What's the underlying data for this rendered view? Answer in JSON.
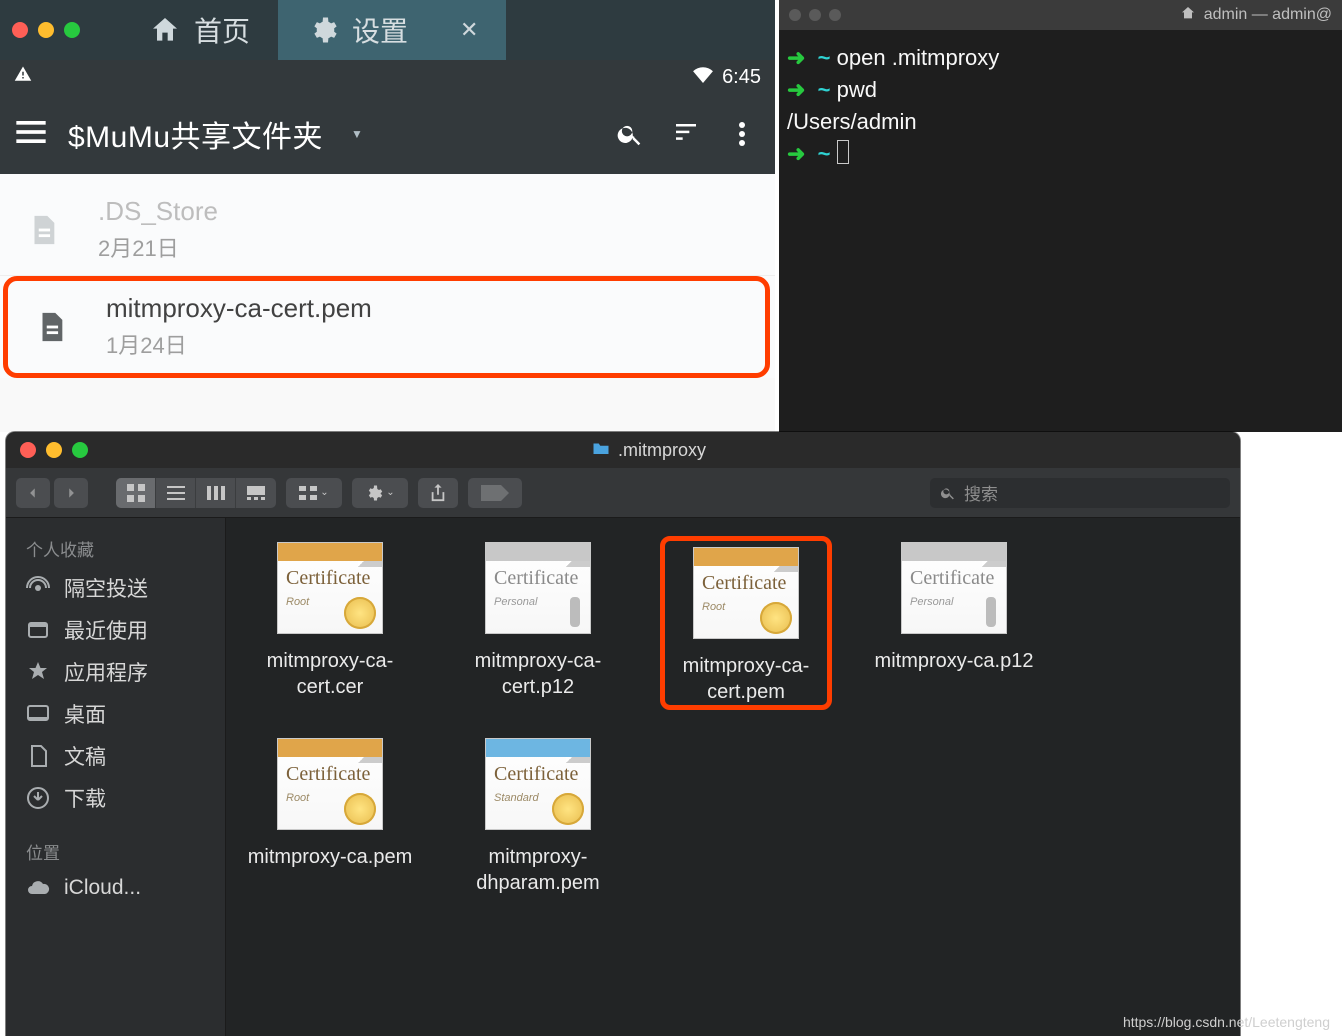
{
  "android": {
    "tabs": [
      {
        "label": "首页"
      },
      {
        "label": "设置"
      }
    ],
    "status_time": "6:45",
    "folder_title": "$MuMu共享文件夹",
    "files": [
      {
        "name": ".DS_Store",
        "date": "2月21日"
      },
      {
        "name": "mitmproxy-ca-cert.pem",
        "date": "1月24日"
      }
    ]
  },
  "terminal": {
    "title": "admin — admin@",
    "lines": [
      {
        "prompt": "➜",
        "tilde": "~",
        "cmd": "open .mitmproxy"
      },
      {
        "prompt": "➜",
        "tilde": "~",
        "cmd": "pwd"
      }
    ],
    "output": "/Users/admin",
    "cursor_line": {
      "prompt": "➜",
      "tilde": "~"
    }
  },
  "finder": {
    "title": ".mitmproxy",
    "search_placeholder": "搜索",
    "sidebar": {
      "fav_label": "个人收藏",
      "items": [
        "隔空投送",
        "最近使用",
        "应用程序",
        "桌面",
        "文稿",
        "下载"
      ],
      "loc_label": "位置",
      "loc_items": [
        "iCloud..."
      ]
    },
    "files": [
      {
        "label": "mitmproxy-ca-cert.cer",
        "kind": "root"
      },
      {
        "label": "mitmproxy-ca-cert.p12",
        "kind": "personal"
      },
      {
        "label": "mitmproxy-ca-cert.pem",
        "kind": "root",
        "highlight": true
      },
      {
        "label": "mitmproxy-ca.p12",
        "kind": "personal"
      },
      {
        "label": "mitmproxy-ca.pem",
        "kind": "root"
      },
      {
        "label": "mitmproxy-dhparam.pem",
        "kind": "standard"
      }
    ]
  },
  "watermark": "https://blog.csdn.net/Leetengteng"
}
